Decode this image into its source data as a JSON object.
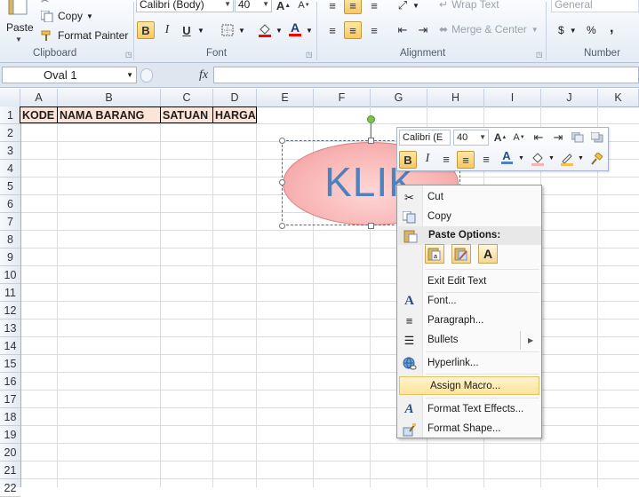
{
  "ribbon": {
    "clipboard": {
      "paste_label": "Paste",
      "copy_label": "Copy",
      "format_painter_label": "Format Painter",
      "group_label": "Clipboard"
    },
    "font": {
      "font_name": "Calibri (Body)",
      "font_size": "40",
      "bold": "B",
      "italic": "I",
      "underline": "U",
      "group_label": "Font"
    },
    "alignment": {
      "wrap_text_label": "Wrap Text",
      "merge_center_label": "Merge & Center",
      "group_label": "Alignment"
    },
    "number": {
      "format_value": "General",
      "currency_symbol": "$",
      "percent_symbol": "%",
      "comma_symbol": ",",
      "group_label": "Number"
    }
  },
  "formula_bar": {
    "name_box_value": "Oval 1",
    "fx_label": "fx",
    "formula_value": ""
  },
  "columns": [
    "A",
    "B",
    "C",
    "D",
    "E",
    "F",
    "G",
    "H",
    "I",
    "J",
    "K"
  ],
  "rows": [
    "1",
    "2",
    "3",
    "4",
    "5",
    "6",
    "7",
    "8",
    "9",
    "10",
    "11",
    "12",
    "13",
    "14",
    "15",
    "16",
    "17",
    "18",
    "19",
    "20",
    "21",
    "22"
  ],
  "header_cells": {
    "a1": "KODE",
    "b1": "NAMA BARANG",
    "c1": "SATUAN",
    "d1": "HARGA",
    "fill_color": "#fce4d6"
  },
  "shape": {
    "text": "KLIK",
    "fill_color": "#f8b3b3",
    "text_color": "#4f81bd"
  },
  "mini_toolbar": {
    "font_name": "Calibri (E",
    "font_size": "40",
    "bold": "B",
    "italic": "I"
  },
  "context_menu": {
    "items": [
      {
        "label": "Cut",
        "icon": "scissors-icon"
      },
      {
        "label": "Copy",
        "icon": "copy-icon"
      },
      {
        "label": "Paste Options:",
        "icon": "paste-icon"
      },
      {
        "label": "Exit Edit Text",
        "icon": ""
      },
      {
        "label": "Font...",
        "icon": "font-icon"
      },
      {
        "label": "Paragraph...",
        "icon": "paragraph-icon"
      },
      {
        "label": "Bullets",
        "icon": "bullets-icon"
      },
      {
        "label": "Hyperlink...",
        "icon": "hyperlink-icon"
      },
      {
        "label": "Assign Macro...",
        "icon": ""
      },
      {
        "label": "Format Text Effects...",
        "icon": "text-effects-icon"
      },
      {
        "label": "Format Shape...",
        "icon": "format-shape-icon"
      }
    ],
    "highlighted": "Assign Macro...",
    "paste_option_a": "A"
  },
  "colors": {
    "ribbon_bg": "#e4ebf5",
    "highlight": "#fde49a",
    "shape_text": "#4f81bd"
  }
}
